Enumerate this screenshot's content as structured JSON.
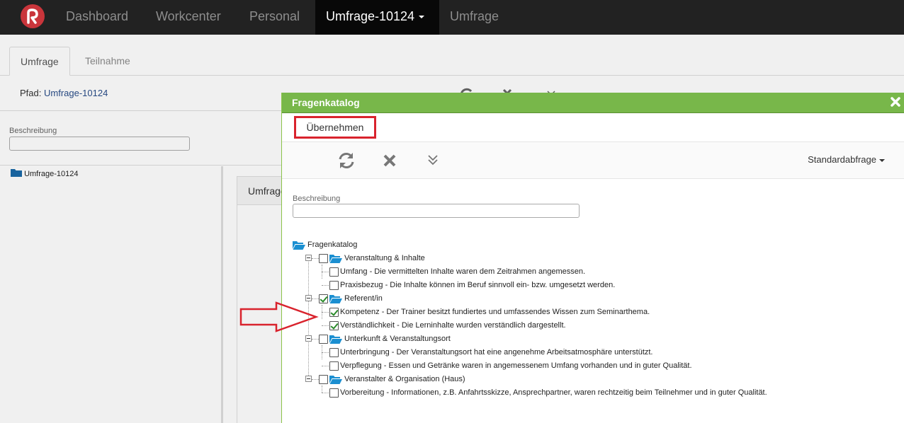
{
  "navbar": {
    "items": [
      {
        "label": "Dashboard"
      },
      {
        "label": "Workcenter"
      },
      {
        "label": "Personal"
      },
      {
        "label": "Umfrage-10124",
        "active": true
      },
      {
        "label": "Umfrage"
      }
    ]
  },
  "background": {
    "tabs": [
      {
        "label": "Umfrage",
        "active": true
      },
      {
        "label": "Teilnahme"
      }
    ],
    "path_label": "Pfad:",
    "path_value": "Umfrage-10124",
    "description_label": "Beschreibung",
    "tree_root": "Umfrage-10124",
    "panel_title": "Umfrage"
  },
  "modal": {
    "title": "Fragenkatalog",
    "apply_button": "Übernehmen",
    "query_dropdown": "Standardabfrage",
    "description_label": "Beschreibung",
    "description_value": "",
    "tree": {
      "root": "Fragenkatalog",
      "groups": [
        {
          "label": "Veranstaltung & Inhalte",
          "checked": false,
          "items": [
            {
              "label": "Umfang - Die vermittelten Inhalte waren dem Zeitrahmen angemessen.",
              "checked": false
            },
            {
              "label": "Praxisbezug - Die Inhalte können im Beruf sinnvoll ein- bzw. umgesetzt werden.",
              "checked": false
            }
          ]
        },
        {
          "label": "Referent/in",
          "checked": true,
          "items": [
            {
              "label": "Kompetenz - Der Trainer besitzt fundiertes und umfassendes Wissen zum Seminarthema.",
              "checked": true
            },
            {
              "label": "Verständlichkeit - Die Lerninhalte wurden verständlich dargestellt.",
              "checked": true
            }
          ]
        },
        {
          "label": "Unterkunft & Veranstaltungsort",
          "checked": false,
          "items": [
            {
              "label": "Unterbringung - Der Veranstaltungsort hat eine angenehme Arbeitsatmosphäre unterstützt.",
              "checked": false
            },
            {
              "label": "Verpflegung - Essen und Getränke waren in angemessenem Umfang vorhanden und in guter Qualität.",
              "checked": false
            }
          ]
        },
        {
          "label": "Veranstalter & Organisation (Haus)",
          "checked": false,
          "items": [
            {
              "label": "Vorbereitung - Informationen, z.B. Anfahrtsskizze, Ansprechpartner, waren rechtzeitig beim Teilnehmer und in guter Qualität.",
              "checked": false
            }
          ]
        }
      ]
    }
  },
  "colors": {
    "navbar_bg": "#222222",
    "modal_header": "#78b74a",
    "highlight_red": "#d9232d",
    "folder_blue": "#1b8fd1"
  }
}
